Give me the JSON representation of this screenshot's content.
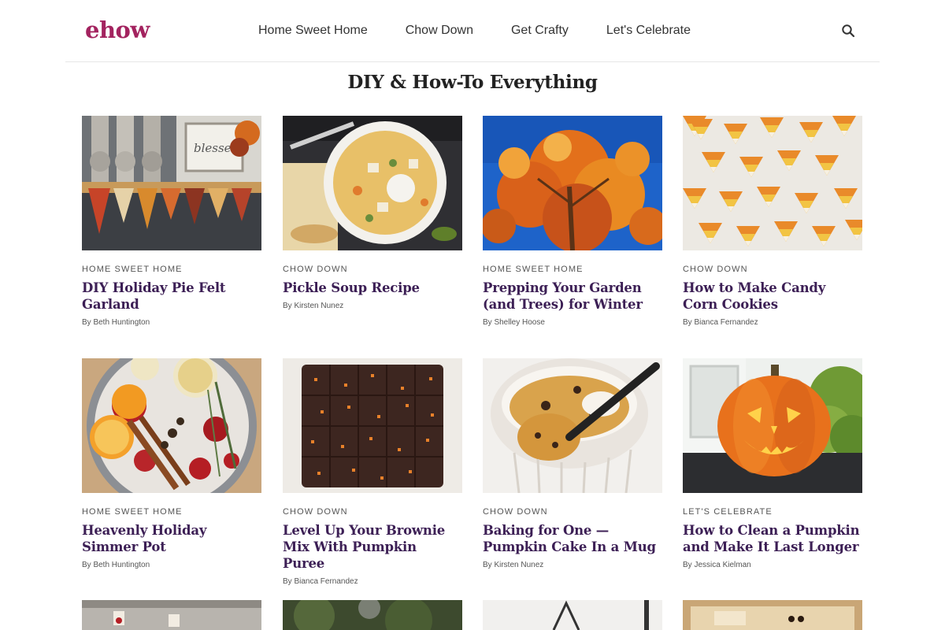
{
  "header": {
    "logo": "ehow",
    "logo_color": "#a3235f",
    "nav": [
      "Home Sweet Home",
      "Chow Down",
      "Get Crafty",
      "Let's Celebrate"
    ],
    "search_icon": "search-icon"
  },
  "page_title": "DIY & How-To Everything",
  "accent_title_color": "#3c1f55",
  "cards": [
    {
      "category": "HOME SWEET HOME",
      "title": "DIY Holiday Pie Felt Garland",
      "author": "By Beth Huntington",
      "image": "pie-felt-garland-mantel"
    },
    {
      "category": "CHOW DOWN",
      "title": "Pickle Soup Recipe",
      "author": "By Kirsten Nunez",
      "image": "bowl-of-pickle-soup"
    },
    {
      "category": "HOME SWEET HOME",
      "title": "Prepping Your Garden (and Trees) for Winter",
      "author": "By Shelley Hoose",
      "image": "orange-autumn-tree-blue-sky"
    },
    {
      "category": "CHOW DOWN",
      "title": "How to Make Candy Corn Cookies",
      "author": "By Bianca Fernandez",
      "image": "candy-corn-cookies"
    },
    {
      "category": "HOME SWEET HOME",
      "title": "Heavenly Holiday Simmer Pot",
      "author": "By Beth Huntington",
      "image": "simmer-pot-fruit-spices"
    },
    {
      "category": "CHOW DOWN",
      "title": "Level Up Your Brownie Mix With Pumpkin Puree",
      "author": "By Bianca Fernandez",
      "image": "pumpkin-brownies"
    },
    {
      "category": "CHOW DOWN",
      "title": "Baking for One — Pumpkin Cake In a Mug",
      "author": "By Kirsten Nunez",
      "image": "pumpkin-mug-cake"
    },
    {
      "category": "LET'S CELEBRATE",
      "title": "How to Clean a Pumpkin and Make It Last Longer",
      "author": "By Jessica Kielman",
      "image": "carved-jack-o-lantern"
    }
  ],
  "partial_row_images": [
    "baking-sheet-treats",
    "outdoor-greenery",
    "hanging-utensils",
    "mummy-pastries"
  ]
}
